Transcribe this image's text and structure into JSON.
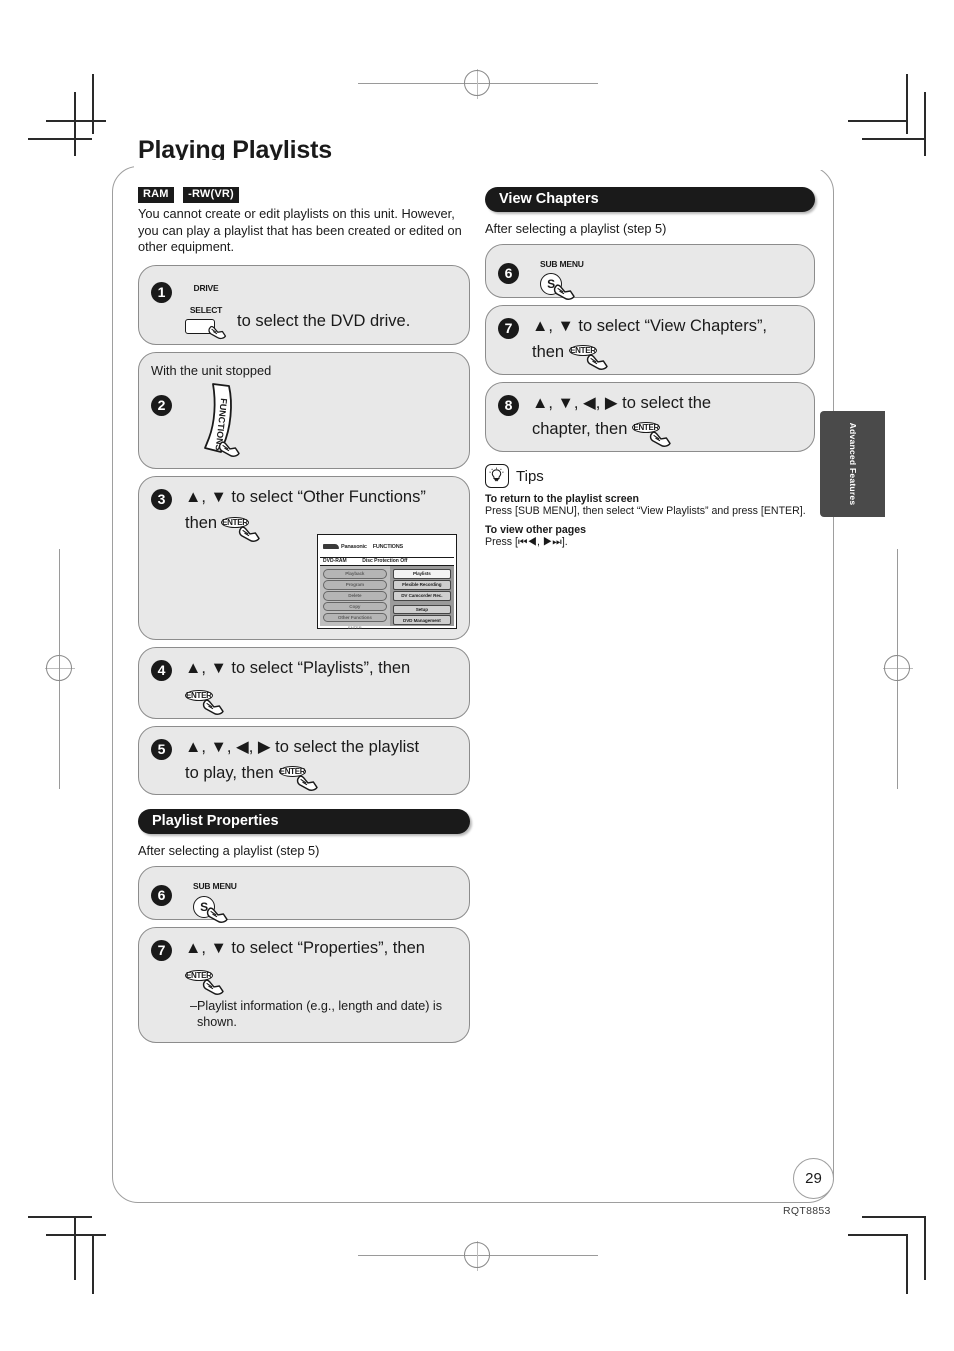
{
  "page": {
    "title": "Playing Playlists",
    "number": "29",
    "doc_code": "RQT8853",
    "side_tab": "Advanced Features"
  },
  "left_column": {
    "badges": [
      "RAM",
      "-RW(VR)"
    ],
    "intro": "You cannot create or edit playlists on this unit. However, you can play a playlist that has been created or edited on other equipment.",
    "steps": [
      {
        "num": "1",
        "key_caption": "DRIVE\nSELECT",
        "text": "to select the DVD drive."
      },
      {
        "num": "2",
        "pre_note": "With the unit stopped",
        "key_caption": "FUNCTIONS",
        "text": ""
      },
      {
        "num": "3",
        "text_a": "▲, ▼ to select “Other Functions”",
        "text_b": "then",
        "key_caption": "ENTER"
      },
      {
        "num": "4",
        "text_a": "▲, ▼ to select “Playlists”, then",
        "key_caption": "ENTER"
      },
      {
        "num": "5",
        "text_a": "▲, ▼, ◀, ▶ to select the playlist",
        "text_b": "to play, then",
        "key_caption": "ENTER"
      }
    ],
    "tv_screen": {
      "brand": "Panasonic",
      "header_label": "FUNCTIONS",
      "disc_type": "DVD-RAM",
      "protection": "Disc Protection Off",
      "left_items": [
        "Playback",
        "Program",
        "Delete",
        "Copy",
        "Other Functions"
      ],
      "right_items": [
        "Playlists",
        "Flexible Recording",
        "DV Camcorder Rec.",
        "Setup",
        "DVD Management"
      ],
      "selected_left": "Other Functions",
      "selected_right": "Playlists",
      "enter_hint": "ENTER"
    },
    "playlist_properties": {
      "heading": "Playlist Properties",
      "after_note": "After selecting a playlist (step 5)",
      "steps": [
        {
          "num": "6",
          "key_caption": "SUB MENU",
          "key_glyph": "S",
          "text": ""
        },
        {
          "num": "7",
          "text_a": "▲, ▼ to select “Properties”, then",
          "key_caption": "ENTER",
          "note": "–Playlist information (e.g., length and date) is shown."
        }
      ]
    }
  },
  "right_column": {
    "view_chapters": {
      "heading": "View Chapters",
      "after_note": "After selecting a playlist (step 5)",
      "steps": [
        {
          "num": "6",
          "key_caption": "SUB MENU",
          "key_glyph": "S",
          "text": ""
        },
        {
          "num": "7",
          "text_a": "▲, ▼ to select “View Chapters”,",
          "text_b": "then",
          "key_caption": "ENTER"
        },
        {
          "num": "8",
          "text_a": "▲, ▼, ◀, ▶ to select the",
          "text_b": "chapter, then",
          "key_caption": "ENTER"
        }
      ]
    },
    "tips": {
      "label": "Tips",
      "entries": [
        {
          "title": "To return to the playlist screen",
          "text": "Press [SUB MENU], then select “View Playlists” and press [ENTER]."
        },
        {
          "title": "To view other pages",
          "text": "Press [⏮◀, ▶⏭]."
        }
      ]
    }
  }
}
